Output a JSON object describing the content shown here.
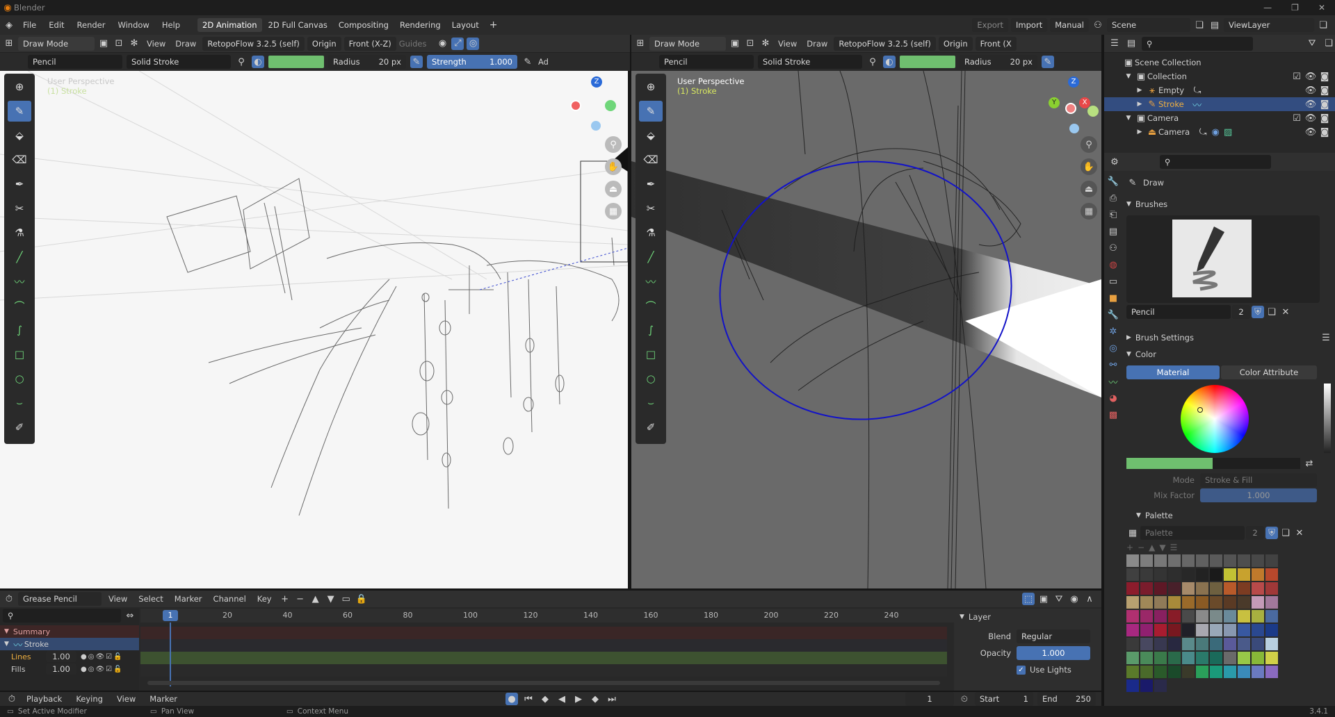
{
  "app": {
    "title": "Blender"
  },
  "menus": [
    "File",
    "Edit",
    "Render",
    "Window",
    "Help"
  ],
  "workspaces": [
    {
      "label": "2D Animation",
      "active": true
    },
    {
      "label": "2D Full Canvas",
      "active": false
    },
    {
      "label": "Compositing",
      "active": false
    },
    {
      "label": "Rendering",
      "active": false
    },
    {
      "label": "Layout",
      "active": false
    }
  ],
  "add_workspace": "+",
  "topright": {
    "export": "Export",
    "import": "Import",
    "manual": "Manual",
    "scene": "Scene",
    "viewlayer": "ViewLayer"
  },
  "viewport_left": {
    "mode": "Draw Mode",
    "view": "View",
    "draw": "Draw",
    "retopoflow": "RetopoFlow 3.2.5 (self)",
    "origin": "Origin",
    "front": "Front (X-Z)",
    "guides": "Guides",
    "brush": "Pencil",
    "stroke": "Solid Stroke",
    "radius_label": "Radius",
    "radius_value": "20 px",
    "strength_label": "Strength",
    "strength_value": "1.000",
    "extra": "Ad",
    "overlay_title": "User Perspective",
    "overlay_sub": "(1) Stroke"
  },
  "viewport_right": {
    "mode": "Draw Mode",
    "view": "View",
    "draw": "Draw",
    "retopoflow": "RetopoFlow 3.2.5 (self)",
    "origin": "Origin",
    "front": "Front (X",
    "brush": "Pencil",
    "stroke": "Solid Stroke",
    "radius_label": "Radius",
    "radius_value": "20 px",
    "overlay_title": "User Perspective",
    "overlay_sub": "(1) Stroke"
  },
  "gizmo": {
    "z": "Z",
    "y": "Y",
    "x": "X"
  },
  "outliner": {
    "rows": [
      {
        "label": "Scene Collection",
        "indent": 0
      },
      {
        "label": "Collection",
        "indent": 1
      },
      {
        "label": "Empty",
        "indent": 2
      },
      {
        "label": "Stroke",
        "indent": 2,
        "selected": true
      },
      {
        "label": "Camera",
        "indent": 1
      },
      {
        "label": "Camera",
        "indent": 2
      }
    ]
  },
  "properties": {
    "tool": "Draw",
    "brushes": "Brushes",
    "brush_name": "Pencil",
    "brush_users": "2",
    "brush_settings": "Brush Settings",
    "color": "Color",
    "material_tab": "Material",
    "color_attr_tab": "Color Attribute",
    "mode_label": "Mode",
    "mode_value": "Stroke & Fill",
    "mix_label": "Mix Factor",
    "mix_value": "1.000",
    "palette": "Palette",
    "palette_name": "Palette",
    "palette_users": "2",
    "swatches": [
      "#8a8a8a",
      "#7d7d7d",
      "#777",
      "#6f6f6f",
      "#676767",
      "#606060",
      "#5a5a5a",
      "#545454",
      "#4e4e4e",
      "#484848",
      "#424242",
      "#404040",
      "#3a3a3a",
      "#343434",
      "#2e2e2e",
      "#282828",
      "#222",
      "#1a1a1a",
      "#c2c234",
      "#c8a22e",
      "#c07a2c",
      "#b8482c",
      "#8c1c2c",
      "#7a1c2c",
      "#5e1826",
      "#48202a",
      "#a68a6a",
      "#8a7250",
      "#6e6040",
      "#b85a2a",
      "#7c3c22",
      "#b84a4a",
      "#a03838",
      "#b8a070",
      "#a08858",
      "#907a58",
      "#a88a3a",
      "#9a6a2a",
      "#8a5a24",
      "#6a4a2a",
      "#5a3a24",
      "#4a3a2a",
      "#c49ab8",
      "#a2789c",
      "#b03070",
      "#9a2868",
      "#882060",
      "#881c28",
      "#4a4a4a",
      "#8a8a8a",
      "#7a8a8a",
      "#6a8a9a",
      "#c8c040",
      "#a8b040",
      "#4a6aa0",
      "#a82880",
      "#902070",
      "#a81c30",
      "#781820",
      "#202028",
      "#a8a8b0",
      "#98a8b8",
      "#8898b0",
      "#3858a0",
      "#2a4890",
      "#1a3a88",
      "#3a3a3a",
      "#484860",
      "#383850",
      "#282840",
      "#5a8a8a",
      "#4a7a7a",
      "#3a6a7a",
      "#5a5a9a",
      "#4a5a8a",
      "#3a4a7a",
      "#b8d0e0",
      "#5a9a6a",
      "#4a8a5a",
      "#3a7a4a",
      "#2a6a4a",
      "#4a8a8a",
      "#2a7a6a",
      "#1a6a5a",
      "#6a6a6a",
      "#98c848",
      "#88b838",
      "#d0d048",
      "#5a7a2a",
      "#4a6a2a",
      "#2a5a2a",
      "#1a4a2a",
      "#3a3a2a",
      "#2aa05a",
      "#1a9a7a",
      "#2a9aaa",
      "#3a8aba",
      "#6a7ac0",
      "#8a6ac0",
      "#1a2a8a",
      "#1a1a6a",
      "#2a2a4a"
    ]
  },
  "timeline": {
    "mode": "Grease Pencil",
    "view": "View",
    "select": "Select",
    "marker": "Marker",
    "channel": "Channel",
    "key": "Key",
    "frame_marks": [
      "20",
      "40",
      "60",
      "80",
      "100",
      "120",
      "140",
      "160",
      "180",
      "200",
      "220",
      "240"
    ],
    "current_frame": "1",
    "channels": [
      {
        "label": "Summary",
        "value": ""
      },
      {
        "label": "Stroke",
        "value": ""
      },
      {
        "label": "Lines",
        "value": "1.00"
      },
      {
        "label": "Fills",
        "value": "1.00"
      }
    ]
  },
  "layer_panel": {
    "title": "Layer",
    "blend_label": "Blend",
    "blend_value": "Regular",
    "opacity_label": "Opacity",
    "opacity_value": "1.000",
    "use_lights": "Use Lights"
  },
  "playback": {
    "playback": "Playback",
    "keying": "Keying",
    "view": "View",
    "marker": "Marker",
    "frame": "1",
    "start_label": "Start",
    "start_value": "1",
    "end_label": "End",
    "end_value": "250"
  },
  "status": {
    "left": "Set Active Modifier",
    "mid": "Pan View",
    "right": "Context Menu",
    "version": "3.4.1"
  }
}
